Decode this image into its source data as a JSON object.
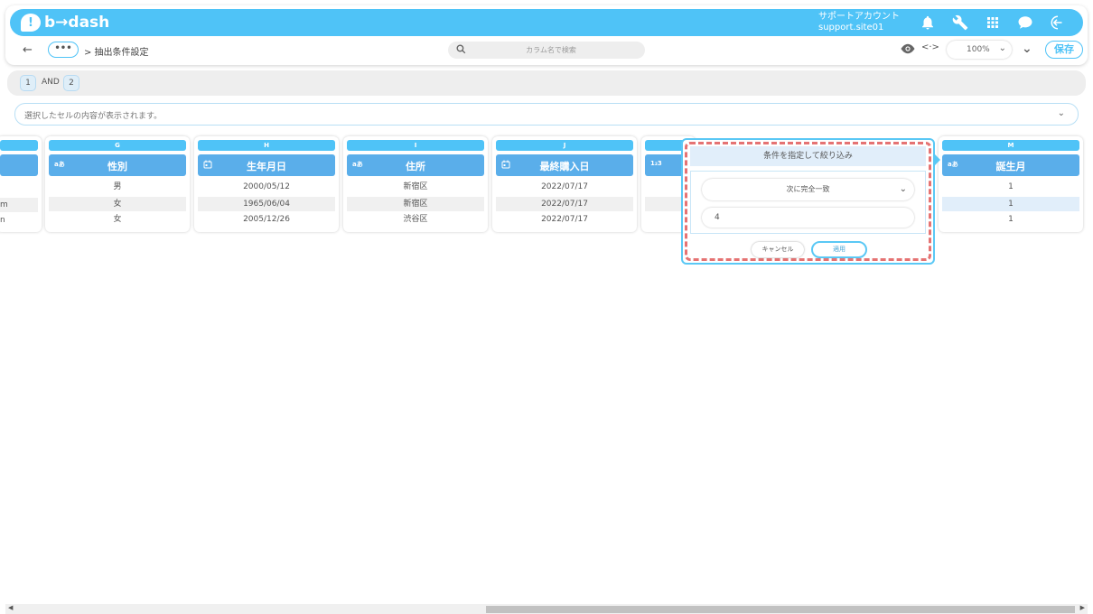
{
  "header": {
    "logo_text": "b→dash",
    "account_line1": "サポートアカウント",
    "account_line2": "support.site01",
    "icons": [
      "bell-icon",
      "wrench-icon",
      "grid-icon",
      "chat-icon",
      "logout-icon"
    ]
  },
  "subheader": {
    "back_label": "←",
    "dots_label": "•••",
    "breadcrumb": "> 抽出条件設定",
    "search_placeholder": "カラム名で検索",
    "code_label": "<·>",
    "zoom": "100%",
    "save_label": "保存"
  },
  "conditions": {
    "chip1": "1",
    "and_label": "AND",
    "chip2": "2"
  },
  "cell_view": {
    "placeholder": "選択したセルの内容が表示されます。"
  },
  "columns": {
    "prev": {
      "rows": [
        "",
        "m",
        "n"
      ]
    },
    "g": {
      "letter": "G",
      "type_icon": "aあ",
      "title": "性別",
      "rows": [
        "男",
        "女",
        "女"
      ]
    },
    "h": {
      "letter": "H",
      "type_icon": "📅",
      "title": "生年月日",
      "rows": [
        "2000/05/12",
        "1965/06/04",
        "2005/12/26"
      ]
    },
    "i": {
      "letter": "I",
      "type_icon": "aあ",
      "title": "住所",
      "rows": [
        "新宿区",
        "新宿区",
        "渋谷区"
      ]
    },
    "j": {
      "letter": "J",
      "type_icon": "📅",
      "title": "最終購入日",
      "rows": [
        "2022/07/17",
        "2022/07/17",
        "2022/07/17"
      ]
    },
    "k": {
      "type_icon": "1₂3"
    },
    "m": {
      "letter": "M",
      "type_icon": "aあ",
      "title": "誕生月",
      "rows": [
        "1",
        "1",
        "1"
      ]
    }
  },
  "filter_popup": {
    "title": "条件を指定して絞り込み",
    "operator": "次に完全一致",
    "value": "4",
    "cancel_label": "キャンセル",
    "apply_label": "適用"
  },
  "colors": {
    "brand": "#4fc3f7",
    "header_fill": "#5aaeea",
    "highlight_dash": "#e57373"
  }
}
